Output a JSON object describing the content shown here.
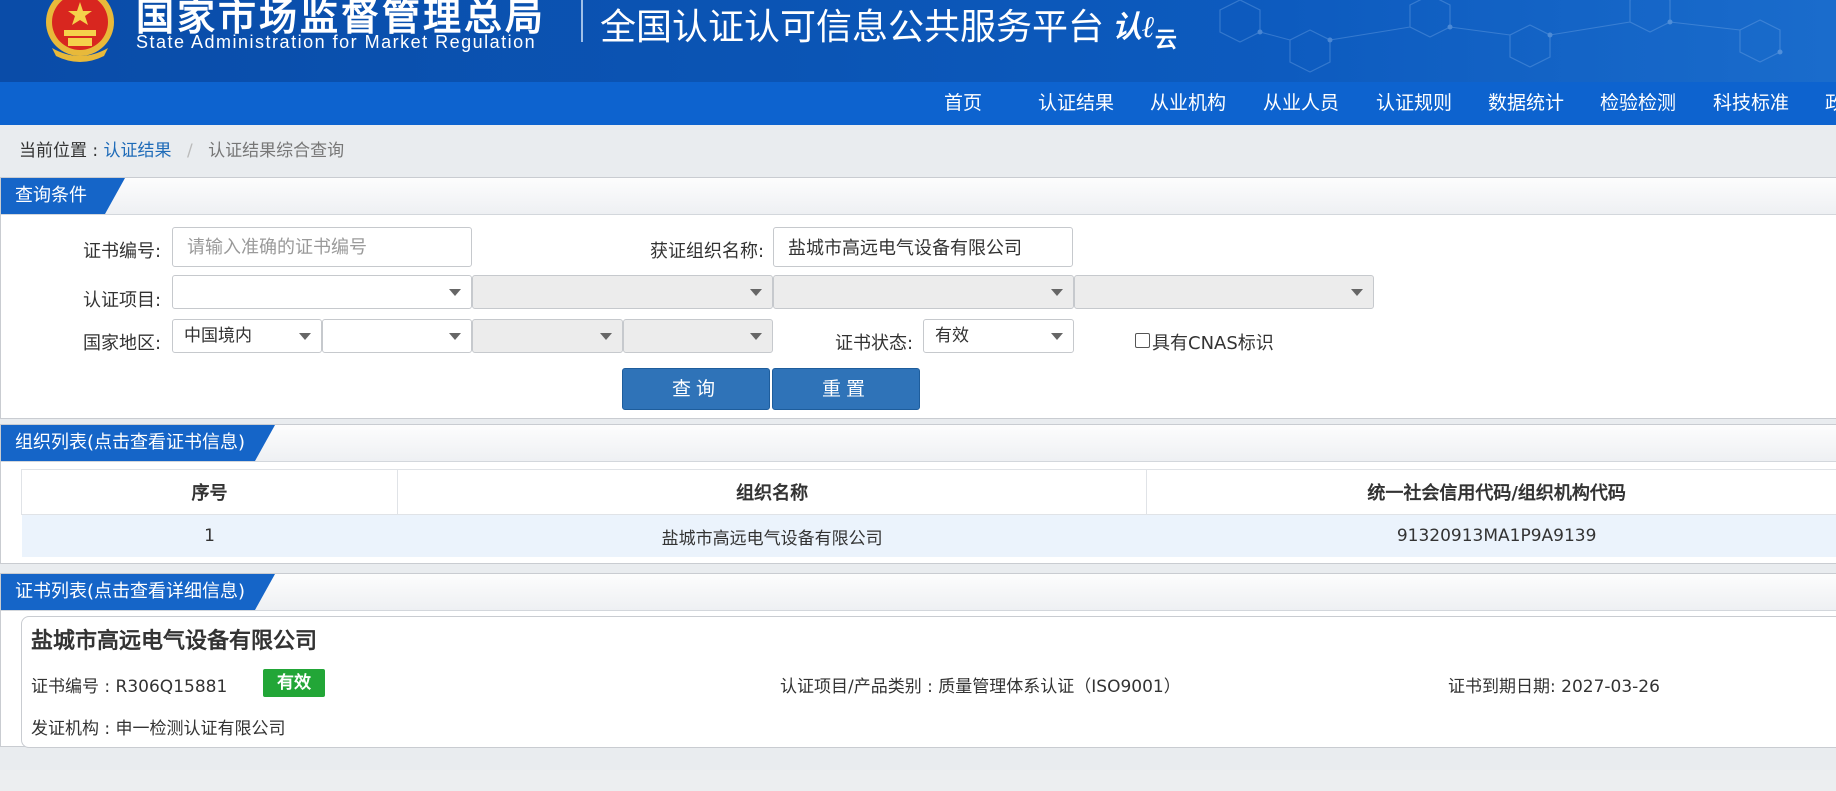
{
  "header": {
    "agency_cn": "国家市场监督管理总局",
    "agency_en": "State Administration  for  Market Regulation",
    "platform_name": "全国认证认可信息公共服务平台",
    "cloud_logo_main": "认",
    "cloud_logo_sub": "云"
  },
  "nav": {
    "items": [
      "首页",
      "认证结果",
      "从业机构",
      "从业人员",
      "认证规则",
      "数据统计",
      "检验检测",
      "科技标准",
      "政"
    ]
  },
  "breadcrumb": {
    "prefix": "当前位置 :",
    "link": "认证结果",
    "separator": "/",
    "current": "认证结果综合查询"
  },
  "query": {
    "title": "查询条件",
    "cert_no_label": "证书编号:",
    "cert_no_placeholder": "请输入准确的证书编号",
    "org_name_label": "获证组织名称:",
    "org_name_value": "盐城市高远电气设备有限公司",
    "project_label": "认证项目:",
    "region_label": "国家地区:",
    "region_value": "中国境内",
    "status_label": "证书状态:",
    "status_value": "有效",
    "cnas_label": "具有CNAS标识",
    "search_button": "查询",
    "reset_button": "重置"
  },
  "org_list": {
    "title": "组织列表(点击查看证书信息)",
    "columns": [
      "序号",
      "组织名称",
      "统一社会信用代码/组织机构代码"
    ],
    "rows": [
      [
        "1",
        "盐城市高远电气设备有限公司",
        "91320913MA1P9A9139"
      ]
    ]
  },
  "cert_list": {
    "title": "证书列表(点击查看详细信息)",
    "company": "盐城市高远电气设备有限公司",
    "cert_no_label": "证书编号 :",
    "cert_no": "R306Q15881",
    "status_badge": "有效",
    "project_label": "认证项目/产品类别 :",
    "project": "质量管理体系认证（ISO9001）",
    "expiry_label": "证书到期日期:",
    "expiry": "2027-03-26",
    "issuer_label": "发证机构 :",
    "issuer": "申一检测认证有限公司"
  },
  "colors": {
    "header_blue": "#0b55b5",
    "nav_blue": "#0d63cf",
    "button_blue": "#2f73b8",
    "link_blue": "#1e6bb8",
    "valid_green": "#22a637",
    "row_highlight": "#ebf3fc"
  }
}
